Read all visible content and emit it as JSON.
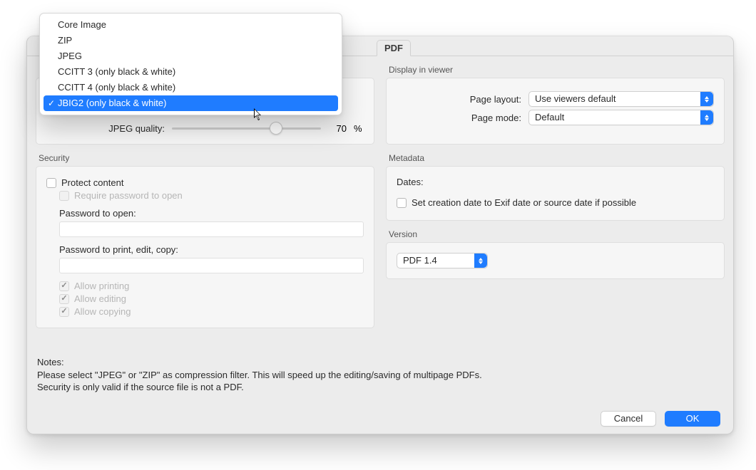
{
  "tab": {
    "label": "PDF"
  },
  "dropdown": {
    "items": [
      {
        "label": "Core Image"
      },
      {
        "label": "ZIP"
      },
      {
        "label": "JPEG"
      },
      {
        "label": "CCITT 3 (only black & white)"
      },
      {
        "label": "CCITT 4 (only black & white)"
      },
      {
        "label": "JBIG2 (only black & white)",
        "selected": true
      }
    ]
  },
  "compression": {
    "quality_label": "JPEG quality:",
    "quality_value": "70",
    "quality_unit": "%"
  },
  "security": {
    "title": "Security",
    "protect_label": "Protect content",
    "require_pw_label": "Require password to open",
    "pw_open_label": "Password to open:",
    "pw_print_label": "Password to print, edit, copy:",
    "allow_printing": "Allow printing",
    "allow_editing": "Allow editing",
    "allow_copying": "Allow copying"
  },
  "display": {
    "title": "Display in viewer",
    "page_layout_label": "Page layout:",
    "page_layout_value": "Use viewers default",
    "page_mode_label": "Page mode:",
    "page_mode_value": "Default"
  },
  "metadata": {
    "title": "Metadata",
    "dates_label": "Dates:",
    "set_creation_label": "Set creation date to Exif date or source date if possible"
  },
  "version": {
    "title": "Version",
    "value": "PDF 1.4"
  },
  "notes": {
    "label": "Notes:",
    "line1": "Please select \"JPEG\" or \"ZIP\" as compression filter. This will speed up the editing/saving of multipage PDFs.",
    "line2": "Security is only valid if the source file is not a PDF."
  },
  "buttons": {
    "cancel": "Cancel",
    "ok": "OK"
  }
}
